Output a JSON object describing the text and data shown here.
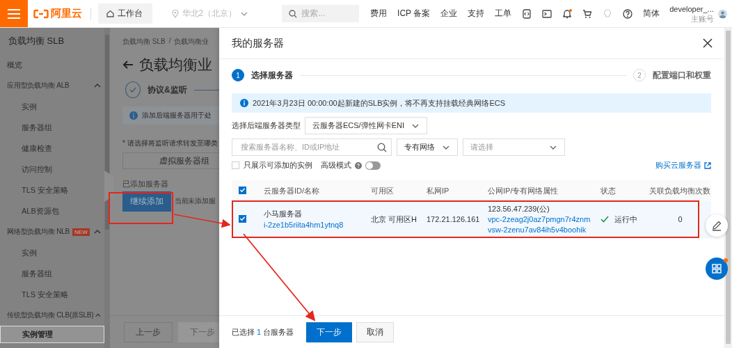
{
  "topbar": {
    "brand": "阿里云",
    "workbench": "工作台",
    "region": "华北2（北京）",
    "search": {
      "placeholder": "搜索..."
    },
    "nav": [
      "费用",
      "ICP 备案",
      "企业",
      "支持",
      "工单"
    ],
    "language": "简体",
    "user": {
      "name": "developer_...",
      "role": "主账号"
    }
  },
  "sidebar": {
    "title": "负载均衡 SLB",
    "items": [
      {
        "label": "概览",
        "selected": false
      },
      {
        "label": "应用型负载均衡 ALB",
        "selected": false,
        "expanded": true,
        "children": [
          {
            "label": "实例",
            "selected": false
          },
          {
            "label": "服务器组",
            "selected": false
          },
          {
            "label": "健康检查",
            "selected": false
          },
          {
            "label": "访问控制",
            "selected": false
          },
          {
            "label": "TLS 安全策略",
            "selected": false
          },
          {
            "label": "ALB资源包",
            "selected": false
          }
        ]
      },
      {
        "label": "网络型负载均衡 NLB",
        "badge": "NEW",
        "selected": false,
        "expanded": true,
        "children": [
          {
            "label": "实例",
            "selected": false
          },
          {
            "label": "服务器组",
            "selected": false
          },
          {
            "label": "TLS 安全策略",
            "selected": false
          }
        ]
      },
      {
        "label": "传统型负载均衡 CLB(原SLB)",
        "selected": false,
        "expanded": true,
        "children": [
          {
            "label": "实例管理",
            "selected": true
          }
        ]
      }
    ]
  },
  "page": {
    "breadcrumb": [
      "负载均衡 SLB",
      "负载均衡业"
    ],
    "breadcrumb_separator": "/",
    "title": "负载均衡业",
    "step": "协议&监听",
    "info": "添加后端服务器用于处",
    "prompt": "* 请选择将监听请求转发至哪类",
    "option": "虚拟服务器组",
    "added_label": "已添加服务器",
    "add_button": "继续添加",
    "empty_text": "当前未添加服",
    "footer_buttons": [
      {
        "label": "上一步",
        "disabled": false
      },
      {
        "label": "下一步",
        "disabled": true
      }
    ]
  },
  "drawer": {
    "title": "我的服务器",
    "steps": [
      {
        "number": "1",
        "label": "选择服务器",
        "selected": true
      },
      {
        "number": "2",
        "label": "配置端口和权重",
        "selected": false
      }
    ],
    "notice": "2021年3月23日 00:00:00起新建的SLB实例，将不再支持挂载经典网络ECS",
    "server_type": {
      "label": "选择后端服务器类型",
      "value": "云服务器ECS/弹性网卡ENI"
    },
    "search": {
      "placeholder": "搜索服务器名称、ID或IP地址"
    },
    "network": {
      "value": "专有网络"
    },
    "vswitch": {
      "placeholder": "请选择"
    },
    "only_addable": {
      "label": "只展示可添加的实例",
      "checked": false
    },
    "advanced": {
      "label": "高级模式",
      "on": false
    },
    "buy_link": "购买云服务器",
    "table": {
      "all_checked": true,
      "columns": [
        "云服务器ID/名称",
        "可用区",
        "私网IP",
        "公网IP/专有网络属性",
        "状态",
        "关联负载均衡次数"
      ],
      "rows": [
        {
          "checked": true,
          "selected": true,
          "name": "小马服务器",
          "id": "i-2ze1b5riita4hm1ytnq8",
          "zone": "北京 可用区H",
          "private_ip": "172.21.126.161",
          "public_ip": "123.56.47.239(公)",
          "vpc": "vpc-2zeag2j0az7pmgn7r4znm",
          "vswitch": "vsw-2zenu7av84ih5v4boohik",
          "status": "运行中",
          "count": "0"
        }
      ]
    },
    "footer": {
      "prefix": "已选择",
      "count": "1",
      "suffix": "台服务器",
      "buttons": [
        {
          "label": "下一步",
          "kind": "primary"
        },
        {
          "label": "取消",
          "kind": "default"
        }
      ]
    }
  }
}
